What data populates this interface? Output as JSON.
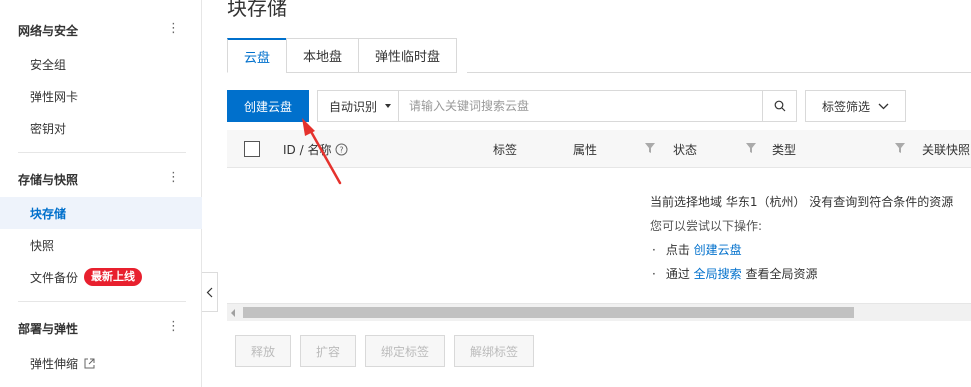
{
  "sidebar": {
    "groups": [
      {
        "title": "网络与安全",
        "items": [
          "安全组",
          "弹性网卡",
          "密钥对"
        ]
      },
      {
        "title": "存储与快照",
        "items": [
          "块存储",
          "快照",
          "文件备份"
        ]
      },
      {
        "title": "部署与弹性",
        "items": [
          "弹性伸缩"
        ]
      }
    ],
    "active_item": "块存储",
    "badge": "最新上线",
    "dots": "⋮"
  },
  "main": {
    "title": "块存储",
    "tabs": [
      "云盘",
      "本地盘",
      "弹性临时盘"
    ],
    "active_tab": "云盘",
    "create_button": "创建云盘",
    "search": {
      "select": "自动识别",
      "placeholder": "请输入关键词搜索云盘"
    },
    "tag_filter": "标签筛选",
    "columns": [
      "ID / 名称",
      "标签",
      "属性",
      "状态",
      "类型",
      "关联快照"
    ],
    "empty": {
      "line1": "当前选择地域 华东1（杭州） 没有查询到符合条件的资源",
      "line2": "您可以尝试以下操作:",
      "op1_prefix": "点击",
      "op1_link": "创建云盘",
      "op2_prefix": "通过",
      "op2_link": "全局搜索",
      "op2_suffix": "查看全局资源",
      "bullet": "·"
    },
    "footer_buttons": [
      "释放",
      "扩容",
      "绑定标签",
      "解绑标签"
    ]
  },
  "colors": {
    "accent": "#0070cc",
    "badge": "#e8202e",
    "annotation_arrow": "#e5322d"
  }
}
